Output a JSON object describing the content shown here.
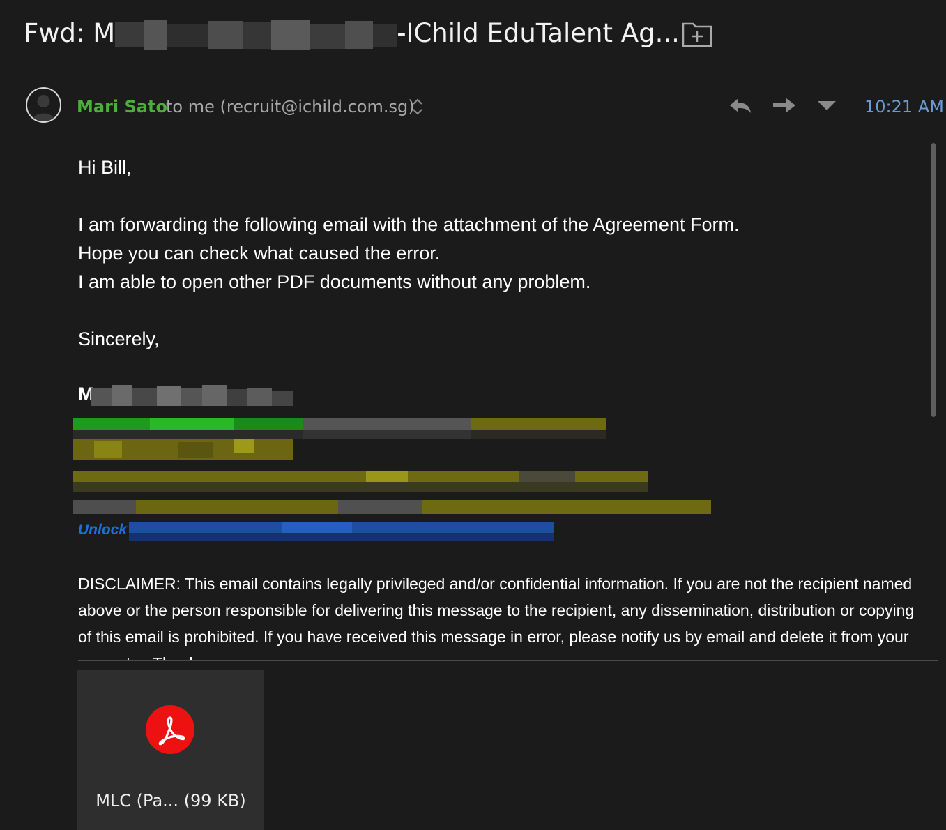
{
  "subject": {
    "text": "Fwd: M███ (████████████)-IChild EduTalent Ag...",
    "visible_prefix": "Fwd: M",
    "visible_suffix": "-IChild EduTalent Ag..."
  },
  "header": {
    "sender": "Mari Sato",
    "recipient": "to me (recruit@ichild.com.sg)",
    "time": "10:21 AM"
  },
  "body": {
    "greeting": "Hi Bill,",
    "lines": [
      "I am forwarding the following email with the attachment of the Agreement Form.",
      "Hope you can check what caused the error.",
      "I am able to open other PDF documents without any problem."
    ],
    "closing": "Sincerely,",
    "signature_initial": "M",
    "signature_link_fragment": "Unlock",
    "disclaimer": "DISCLAIMER: This email contains legally privileged and/or confidential information. If you are not the recipient named above or the person responsible for delivering this message to the recipient, any dissemination, distribution or copying of this email is prohibited. If you have received this message in error, please notify us by email and delete it from your computer. Thank you."
  },
  "attachment": {
    "label": "MLC (Pa... (99 KB)",
    "icon": "pdf-icon"
  },
  "icons": {
    "folder": "new-folder-icon",
    "reply": "reply-icon",
    "forward": "forward-icon",
    "more": "chevron-down-icon",
    "expand": "expand-collapse-icon"
  },
  "colors": {
    "background": "#1b1b1b",
    "sender": "#4caf3a",
    "time": "#6d9bd1",
    "pdf": "#ee1111",
    "attachment_tile": "#2e2e2e"
  }
}
